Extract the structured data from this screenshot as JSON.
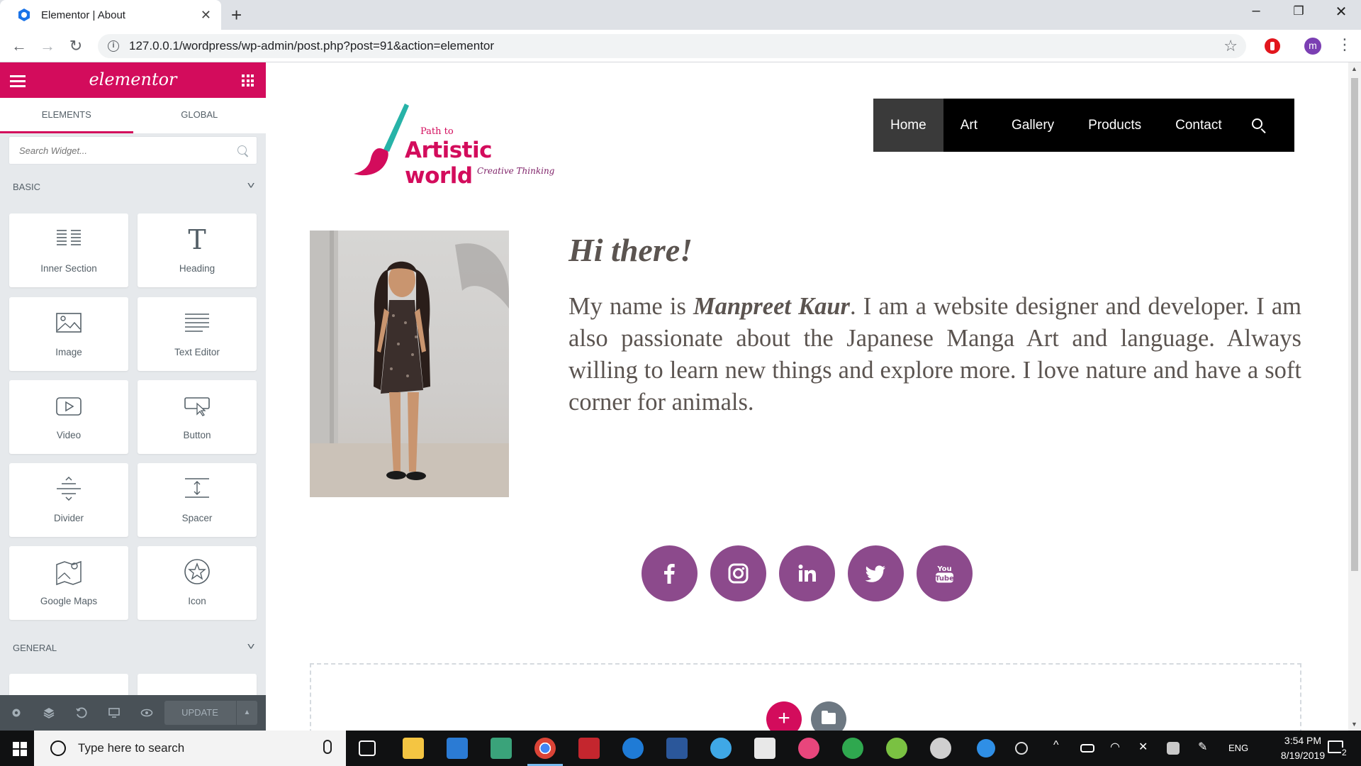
{
  "browser": {
    "tab_title": "Elementor | About",
    "url": "127.0.0.1/wordpress/wp-admin/post.php?post=91&action=elementor",
    "profile_initial": "m",
    "accent": "#d30c5c"
  },
  "panel": {
    "logo": "elementor",
    "tabs": [
      {
        "label": "ELEMENTS",
        "active": true
      },
      {
        "label": "GLOBAL",
        "active": false
      }
    ],
    "search_placeholder": "Search Widget...",
    "categories": {
      "basic": "BASIC",
      "general": "GENERAL"
    },
    "widgets": [
      {
        "label": "Inner Section",
        "icon": "inner-section-icon"
      },
      {
        "label": "Heading",
        "icon": "heading-icon"
      },
      {
        "label": "Image",
        "icon": "image-icon"
      },
      {
        "label": "Text Editor",
        "icon": "text-editor-icon"
      },
      {
        "label": "Video",
        "icon": "video-icon"
      },
      {
        "label": "Button",
        "icon": "button-icon"
      },
      {
        "label": "Divider",
        "icon": "divider-icon"
      },
      {
        "label": "Spacer",
        "icon": "spacer-icon"
      },
      {
        "label": "Google Maps",
        "icon": "google-maps-icon"
      },
      {
        "label": "Icon",
        "icon": "star-icon"
      }
    ],
    "footer": {
      "update_label": "UPDATE"
    }
  },
  "site": {
    "logo": {
      "path_to": "Path to",
      "brand": "Artistic world",
      "tagline": "Creative Thinking"
    },
    "nav": [
      {
        "label": "Home",
        "active": true
      },
      {
        "label": "Art",
        "active": false
      },
      {
        "label": "Gallery",
        "active": false
      },
      {
        "label": "Products",
        "active": false
      },
      {
        "label": "Contact",
        "active": false
      }
    ],
    "heading": "Hi there!",
    "bio": {
      "before": "My name is ",
      "name": "Manpreet Kaur",
      "after": ". I am a website designer and developer. I am also passionate about the Japanese Manga Art and language. Always willing to learn new things and explore more. I love nature and have a soft corner for animals."
    },
    "social": [
      "facebook-icon",
      "instagram-icon",
      "linkedin-icon",
      "twitter-icon",
      "youtube-icon"
    ],
    "social_color": "#8c4a8c"
  },
  "taskbar": {
    "search_placeholder": "Type here to search",
    "lang": "ENG",
    "time": "3:54 PM",
    "date": "8/19/2019",
    "notifications": "2"
  }
}
